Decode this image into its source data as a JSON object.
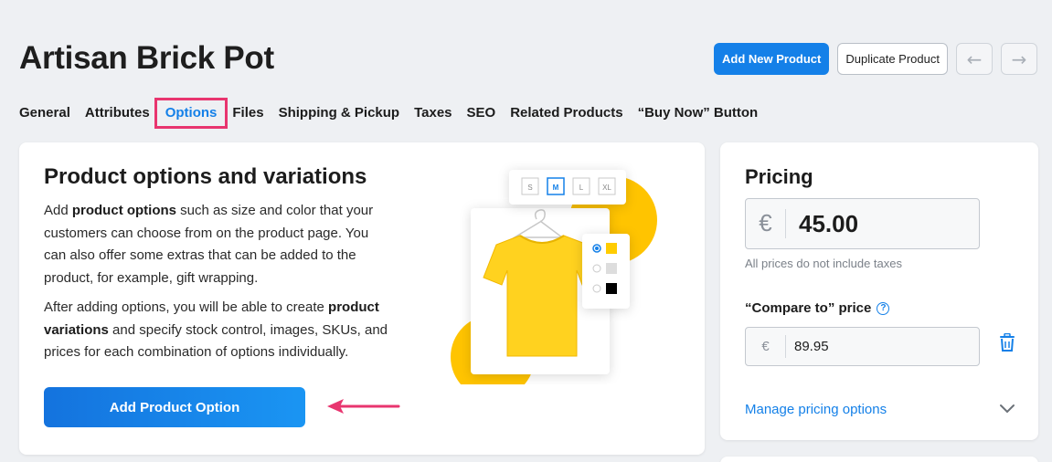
{
  "page": {
    "title": "Artisan Brick Pot"
  },
  "header_actions": {
    "add_new_product": "Add New Product",
    "duplicate_product": "Duplicate Product",
    "prev_icon": "arrow-left-icon",
    "next_icon": "arrow-right-icon"
  },
  "tabs": [
    {
      "label": "General",
      "active": false
    },
    {
      "label": "Attributes",
      "active": false
    },
    {
      "label": "Options",
      "active": true
    },
    {
      "label": "Files",
      "active": false
    },
    {
      "label": "Shipping & Pickup",
      "active": false
    },
    {
      "label": "Taxes",
      "active": false
    },
    {
      "label": "SEO",
      "active": false
    },
    {
      "label": "Related Products",
      "active": false
    },
    {
      "label": "“Buy Now” Button",
      "active": false
    }
  ],
  "options_card": {
    "title": "Product options and variations",
    "p1_a": "Add ",
    "p1_b": "product options",
    "p1_c": " such as size and color that your customers can choose from on the product page. You can also offer some extras that can be added to the product, for example, gift wrapping.",
    "p2_a": "After adding options, you will be able to create ",
    "p2_b": "product variations",
    "p2_c": " and specify stock control, images, SKUs, and prices for each combination of options individually.",
    "button": "Add Product Option",
    "illustration": {
      "sizes": [
        "S",
        "M",
        "L",
        "XL"
      ],
      "selected_size": "M",
      "swatches": [
        "#ffcc00",
        "#dddddd",
        "#000000"
      ],
      "accent": "#ffc400",
      "shirt_color": "#ffd21f"
    }
  },
  "pricing": {
    "title": "Pricing",
    "currency": "€",
    "price": "45.00",
    "tax_note": "All prices do not include taxes",
    "compare_label": "“Compare to” price",
    "compare_value": "89.95",
    "manage_link": "Manage pricing options"
  },
  "colors": {
    "primary": "#1480e8",
    "highlight": "#e8356f",
    "background": "#eef0f3"
  }
}
